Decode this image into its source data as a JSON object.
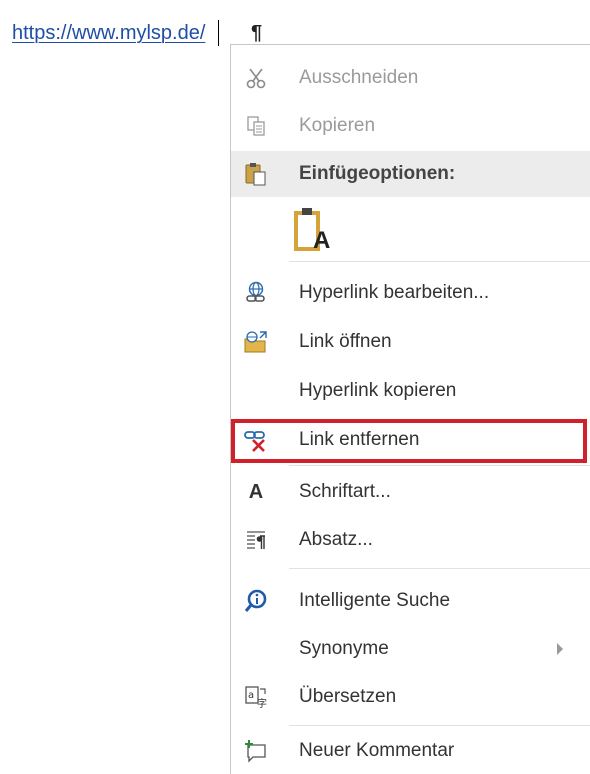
{
  "document": {
    "link_text": "https://www.mylsp.de/",
    "pilcrow": "¶"
  },
  "menu": {
    "items": [
      {
        "label": "Ausschneiden",
        "icon": "scissors-icon",
        "disabled": true
      },
      {
        "label": "Kopieren",
        "icon": "copy-icon",
        "disabled": true
      },
      {
        "label": "Einfügeoptionen:",
        "icon": "paste-icon",
        "header": true
      },
      {
        "label": "",
        "icon": "paste-text-only-icon"
      },
      {
        "label": "Hyperlink bearbeiten...",
        "icon": "edit-hyperlink-icon"
      },
      {
        "label": "Link öffnen",
        "icon": "open-link-icon"
      },
      {
        "label": "Hyperlink kopieren",
        "icon": ""
      },
      {
        "label": "Link entfernen",
        "icon": "remove-link-icon",
        "highlighted": true
      },
      {
        "label": "Schriftart...",
        "icon": "font-icon"
      },
      {
        "label": "Absatz...",
        "icon": "paragraph-icon"
      },
      {
        "label": "Intelligente Suche",
        "icon": "smart-lookup-icon"
      },
      {
        "label": "Synonyme",
        "icon": "",
        "submenu": true
      },
      {
        "label": "Übersetzen",
        "icon": "translate-icon"
      },
      {
        "label": "Neuer Kommentar",
        "icon": "new-comment-icon"
      }
    ],
    "paste_glyph": "A",
    "font_glyph": "A",
    "highlight_color": "#d0202b"
  }
}
